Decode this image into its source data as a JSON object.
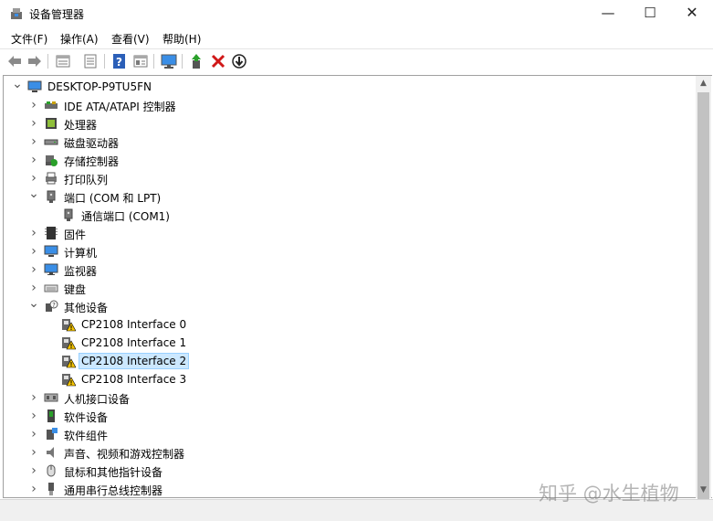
{
  "window": {
    "title": "设备管理器",
    "controls": {
      "minimize": "—",
      "maximize": "☐",
      "close": "✕"
    }
  },
  "menu": [
    "文件(F)",
    "操作(A)",
    "查看(V)",
    "帮助(H)"
  ],
  "toolbar": {
    "buttons": [
      "back-arrow-icon",
      "forward-arrow-icon",
      "properties-icon",
      "print-icon",
      "help-icon",
      "view-icon",
      "monitor-scan-icon",
      "update-driver-icon",
      "uninstall-icon",
      "disable-device-icon"
    ]
  },
  "tree": {
    "root": "DESKTOP-P9TU5FN",
    "items": [
      {
        "label": "IDE ATA/ATAPI 控制器",
        "expanded": false,
        "icon": "ide-controller-icon"
      },
      {
        "label": "处理器",
        "expanded": false,
        "icon": "processor-icon"
      },
      {
        "label": "磁盘驱动器",
        "expanded": false,
        "icon": "disk-drive-icon"
      },
      {
        "label": "存储控制器",
        "expanded": false,
        "icon": "storage-controller-icon"
      },
      {
        "label": "打印队列",
        "expanded": false,
        "icon": "printer-icon"
      },
      {
        "label": "端口 (COM 和 LPT)",
        "expanded": true,
        "icon": "port-icon",
        "children": [
          {
            "label": "通信端口 (COM1)",
            "icon": "port-icon"
          }
        ]
      },
      {
        "label": "固件",
        "expanded": false,
        "icon": "firmware-icon"
      },
      {
        "label": "计算机",
        "expanded": false,
        "icon": "computer-icon"
      },
      {
        "label": "监视器",
        "expanded": false,
        "icon": "monitor-icon"
      },
      {
        "label": "键盘",
        "expanded": false,
        "icon": "keyboard-icon"
      },
      {
        "label": "其他设备",
        "expanded": true,
        "icon": "other-devices-icon",
        "children": [
          {
            "label": "CP2108 Interface 0",
            "icon": "warning-device-icon"
          },
          {
            "label": "CP2108 Interface 1",
            "icon": "warning-device-icon"
          },
          {
            "label": "CP2108 Interface 2",
            "icon": "warning-device-icon",
            "selected": true
          },
          {
            "label": "CP2108 Interface 3",
            "icon": "warning-device-icon"
          }
        ]
      },
      {
        "label": "人机接口设备",
        "expanded": false,
        "icon": "hid-icon"
      },
      {
        "label": "软件设备",
        "expanded": false,
        "icon": "software-device-icon"
      },
      {
        "label": "软件组件",
        "expanded": false,
        "icon": "software-component-icon"
      },
      {
        "label": "声音、视频和游戏控制器",
        "expanded": false,
        "icon": "speaker-icon"
      },
      {
        "label": "鼠标和其他指针设备",
        "expanded": false,
        "icon": "mouse-icon"
      },
      {
        "label": "通用串行总线控制器",
        "expanded": false,
        "icon": "usb-icon"
      }
    ]
  },
  "watermark": "知乎 @水生植物",
  "colors": {
    "selection": "#cce8ff",
    "selection_border": "#99d1ff",
    "warning": "#f5c400",
    "screen_blue": "#3a8ee6"
  }
}
